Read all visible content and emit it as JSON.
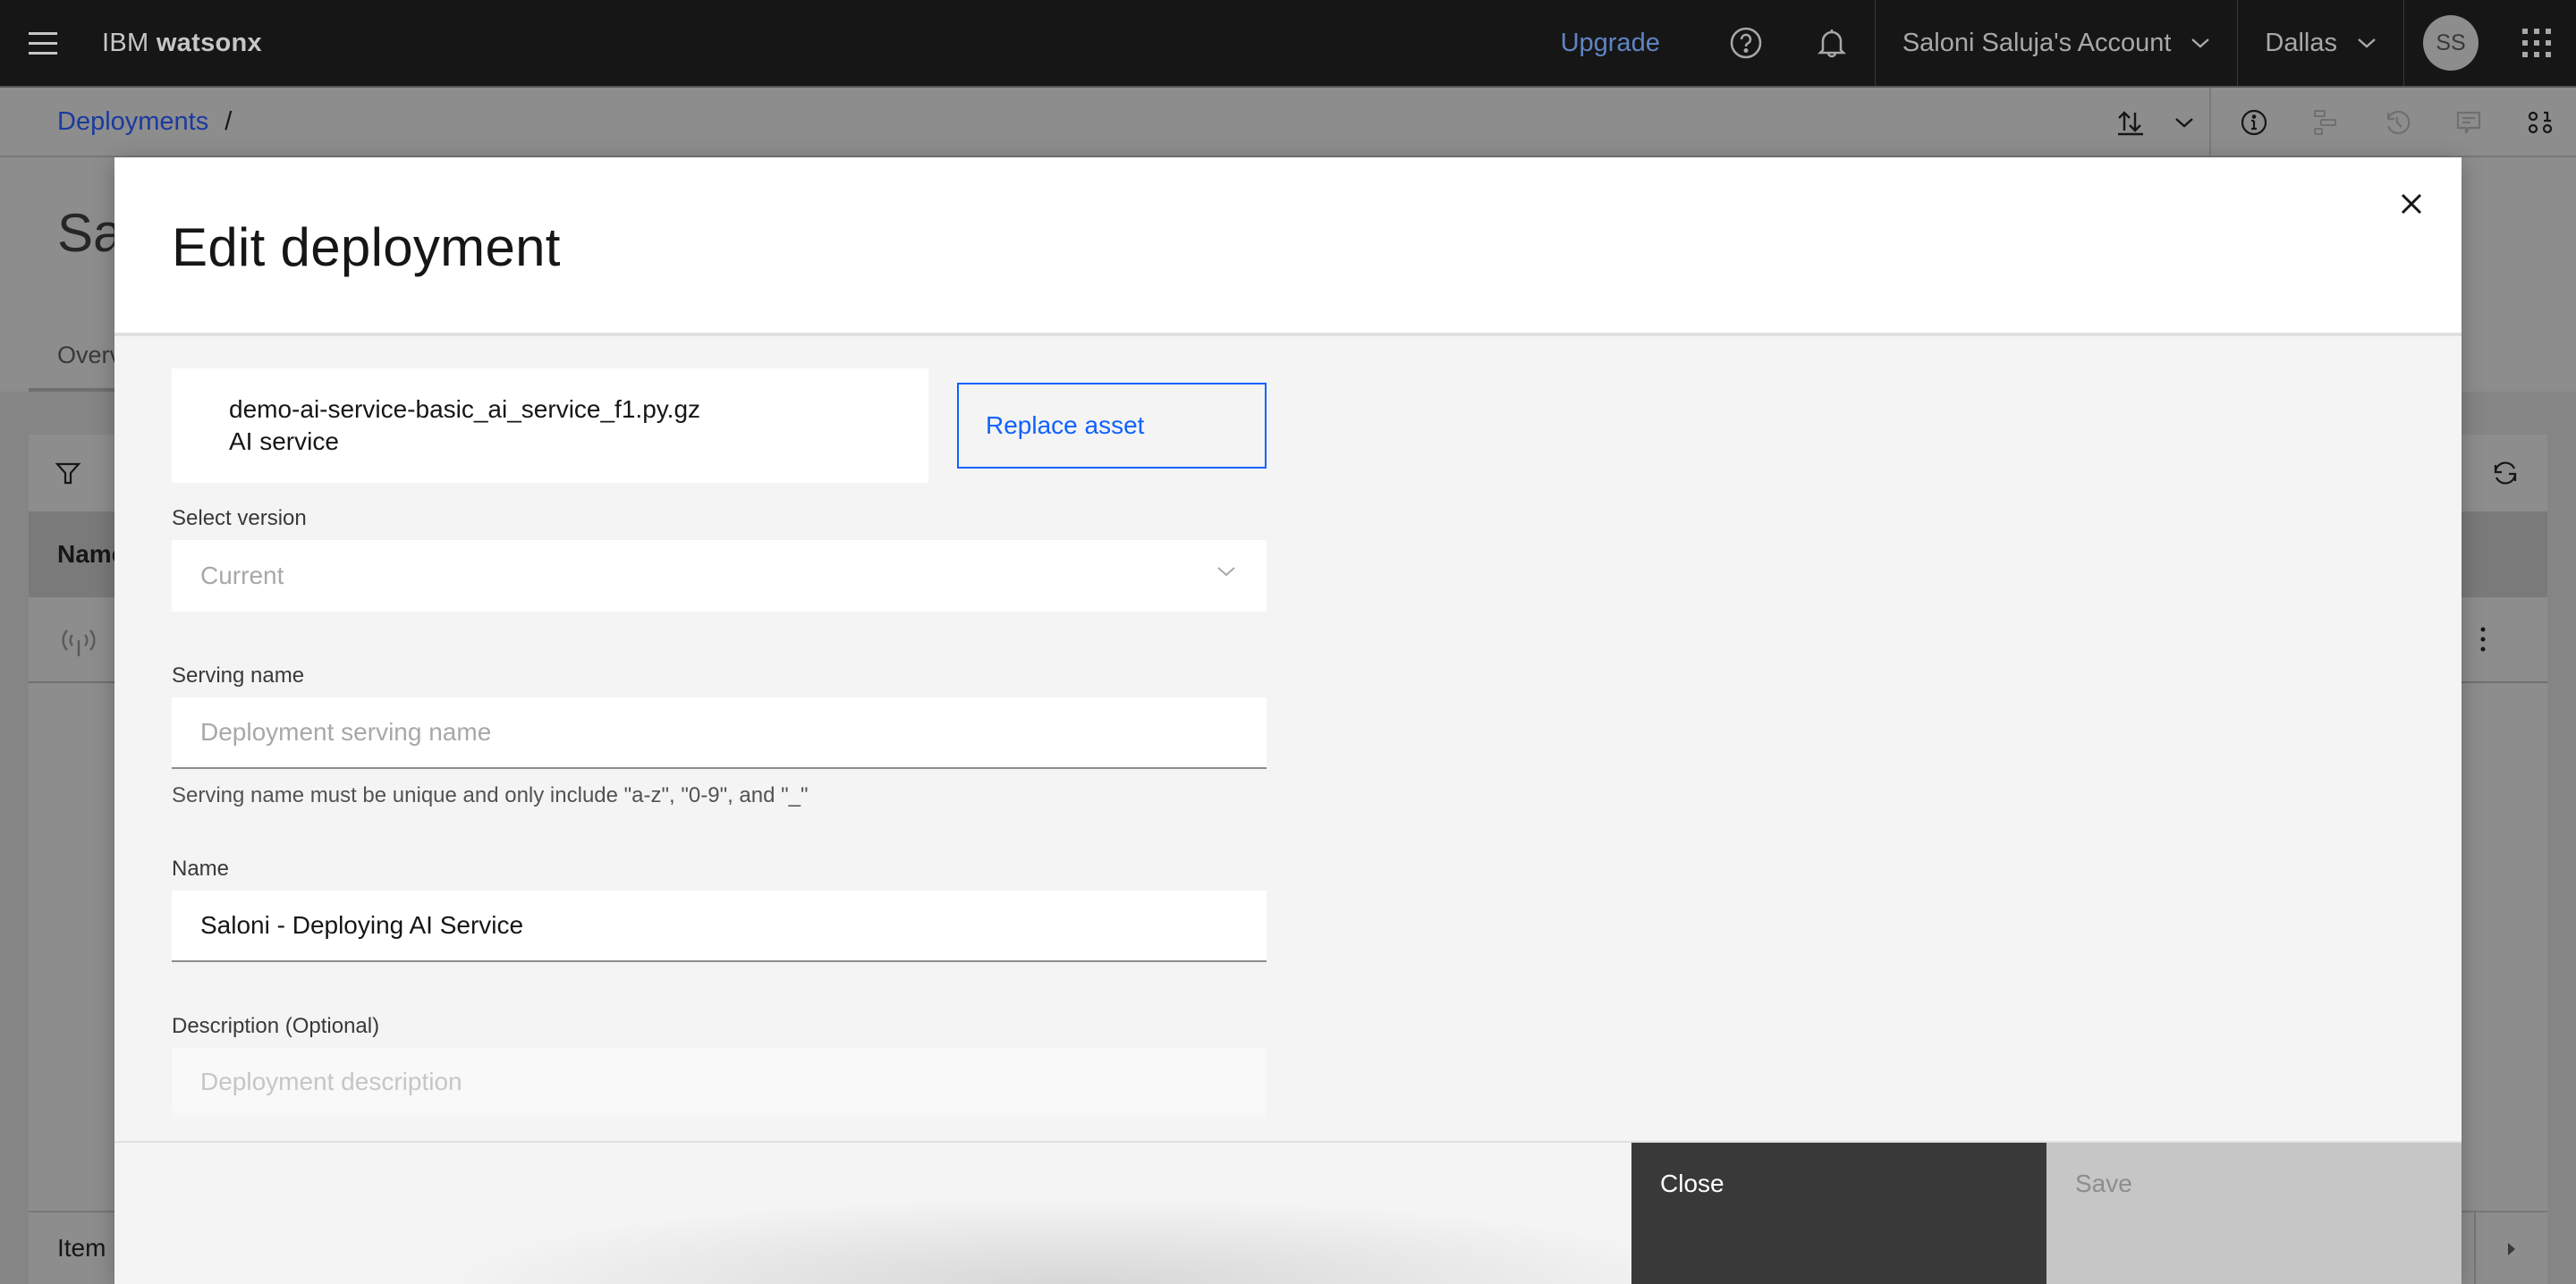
{
  "topbar": {
    "brand_prefix": "IBM",
    "brand_name": "watsonx",
    "upgrade_label": "Upgrade",
    "help_icon": "help-icon",
    "notification_icon": "notification-bell-icon",
    "account_label": "Saloni Saluja's Account",
    "region_label": "Dallas",
    "avatar_initials": "SS",
    "switcher_icon": "app-switcher-icon"
  },
  "page": {
    "breadcrumb": {
      "items": [
        {
          "label": "Deployments"
        }
      ],
      "separator": "/"
    },
    "title_partial": "Sa",
    "tab_partial": "Overv",
    "toolbar_icons": [
      "import-export-icon",
      "chevron-down-icon",
      "info-icon",
      "lineage-icon",
      "history-icon",
      "comment-icon",
      "data-icon"
    ],
    "table": {
      "header_partial": "Name",
      "footer_partial": "Item"
    }
  },
  "modal": {
    "title": "Edit deployment",
    "close_label": "Close",
    "asset": {
      "name": "demo-ai-service-basic_ai_service_f1.py.gz",
      "type": "AI service",
      "replace_label": "Replace asset"
    },
    "version": {
      "label": "Select version",
      "value": "Current"
    },
    "serving_name": {
      "label": "Serving name",
      "placeholder": "Deployment serving name",
      "value": "",
      "helper": "Serving name must be unique and only include \"a-z\", \"0-9\", and \"_\""
    },
    "name": {
      "label": "Name",
      "value": "Saloni - Deploying AI Service"
    },
    "description": {
      "label": "Description (Optional)",
      "placeholder": "Deployment description",
      "value": ""
    },
    "footer": {
      "close_label": "Close",
      "save_label": "Save"
    }
  }
}
